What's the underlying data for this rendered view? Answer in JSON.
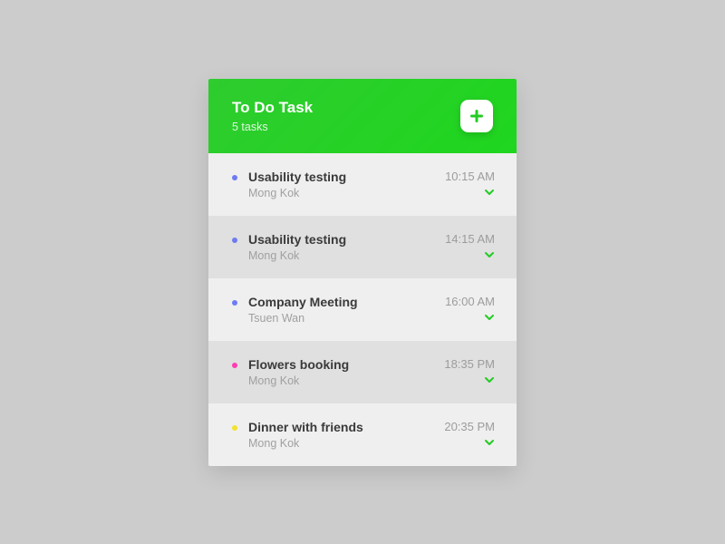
{
  "colors": {
    "accent": "#22cc22",
    "bullet_blue": "#6e7bf2",
    "bullet_pink": "#ff3db0",
    "bullet_yellow": "#f3e22e"
  },
  "header": {
    "title": "To Do Task",
    "subtitle": "5 tasks"
  },
  "tasks": [
    {
      "title": "Usability testing",
      "location": "Mong Kok",
      "time": "10:15 AM",
      "bullet": "bullet_blue"
    },
    {
      "title": "Usability testing",
      "location": "Mong Kok",
      "time": "14:15 AM",
      "bullet": "bullet_blue"
    },
    {
      "title": "Company Meeting",
      "location": "Tsuen Wan",
      "time": "16:00 AM",
      "bullet": "bullet_blue"
    },
    {
      "title": "Flowers booking",
      "location": "Mong Kok",
      "time": "18:35 PM",
      "bullet": "bullet_pink"
    },
    {
      "title": "Dinner with friends",
      "location": "Mong Kok",
      "time": "20:35 PM",
      "bullet": "bullet_yellow"
    }
  ]
}
